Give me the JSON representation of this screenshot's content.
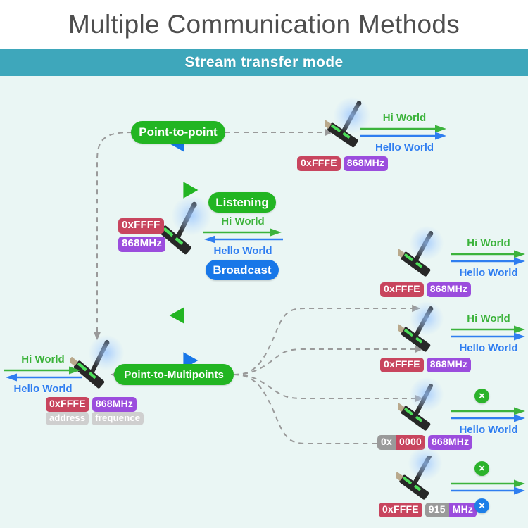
{
  "header": {
    "title": "Multiple Communication Methods",
    "subtitle": "Stream transfer mode",
    "bar_color": "#3ea7bb",
    "canvas_color": "#eaf6f4",
    "title_color": "#4e4e4e"
  },
  "colors": {
    "green": "#22b522",
    "blue": "#1877e8",
    "address_badge": "#c8455e",
    "frequency_badge": "#9b4ddd",
    "gray_badge": "#b1b1b1",
    "hi_text": "#3cb33c",
    "hello_text": "#2f7ef0",
    "dashed_wire": "#9a9a9a"
  },
  "labels": {
    "hi_world": "Hi World",
    "hello_world": "Hello World",
    "address_caption": "address",
    "frequence_caption": "frequence",
    "x_icon": "×"
  },
  "pills": {
    "point_to_point": "Point-to-point",
    "listening": "Listening",
    "broadcast": "Broadcast",
    "point_to_multipoints": "Point-to-Multipoints"
  },
  "nodes": {
    "top_right": {
      "address": "0xFFFE",
      "frequency": "868MHz",
      "hi_world": "Hi World",
      "hello_world": "Hello World",
      "hi_dir": "right",
      "hello_dir": "right"
    },
    "center_hub": {
      "address": "0xFFFF",
      "frequency": "868MHz",
      "hi_world": "Hi World",
      "hello_world": "Hello World",
      "hi_dir": "right",
      "hello_dir": "left"
    },
    "left_peer": {
      "address": "0xFFFE",
      "frequency": "868MHz",
      "address_caption": "address",
      "frequence_caption": "frequence",
      "hi_world": "Hi World",
      "hello_world": "Hello World",
      "hi_dir": "right",
      "hello_dir": "left"
    },
    "multipoint_1": {
      "address": "0xFFFE",
      "frequency": "868MHz",
      "hi_world": "Hi World",
      "hello_world": "Hello World"
    },
    "multipoint_2": {
      "address": "0xFFFE",
      "frequency": "868MHz",
      "hi_world": "Hi World",
      "hello_world": "Hello World"
    },
    "multipoint_3": {
      "address_prefix": "0x",
      "address_value": "0000",
      "frequency": "868MHz",
      "hi_world_blocked": true,
      "hello_world": "Hello World"
    },
    "multipoint_4": {
      "address": "0xFFFE",
      "frequency_value": "915",
      "frequency_unit": "MHz",
      "hi_world_blocked": true,
      "hello_world_blocked": true
    }
  }
}
